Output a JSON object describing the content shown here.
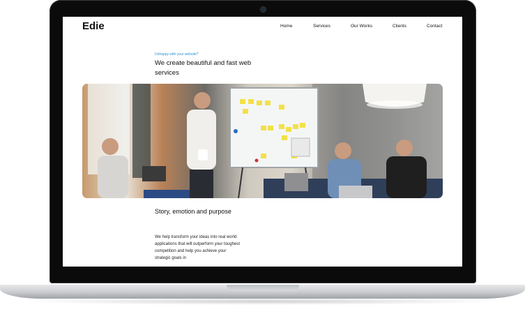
{
  "site": {
    "logo": "Edie",
    "nav": [
      "Home",
      "Services",
      "Our Works",
      "Clients",
      "Contact"
    ],
    "eyebrow": "Unhappy with your website?",
    "headline": "We create beautiful and fast web services",
    "section_title": "Story, emotion and purpose",
    "body": "We help transform your ideas into real world applications that will outperform your toughest competition and help you achieve your strategic goals in"
  },
  "colors": {
    "accent": "#2f8fd6",
    "laptop_bezel": "#0b0b0b",
    "laptop_base": "#c9cbce"
  }
}
